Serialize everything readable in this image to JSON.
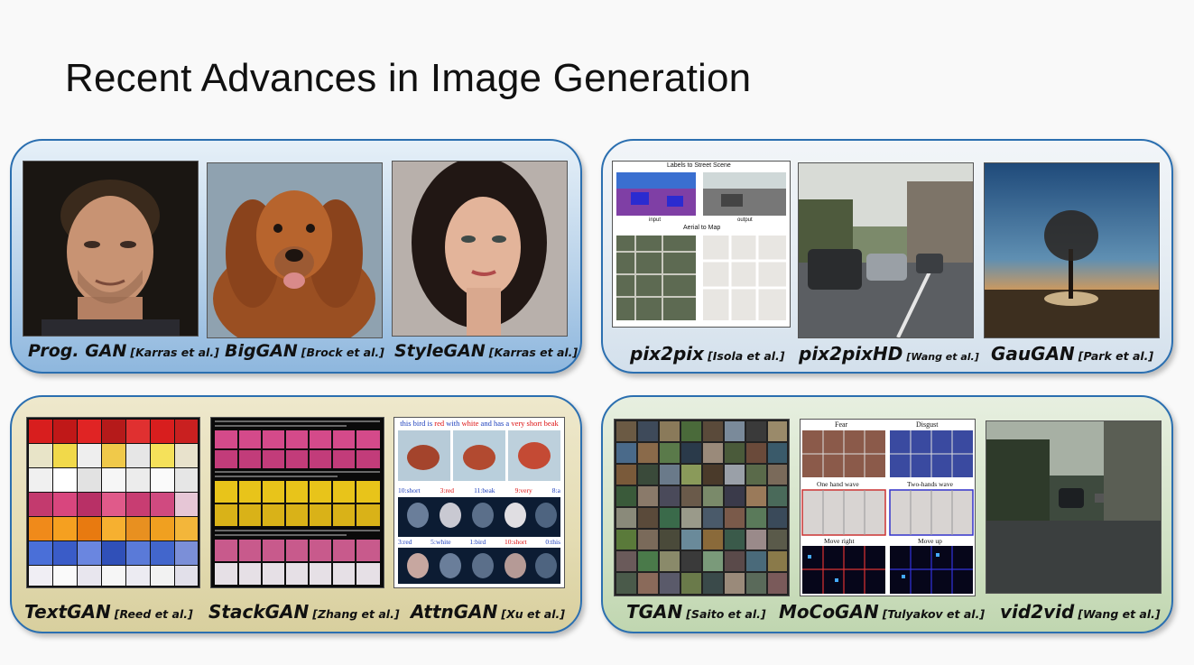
{
  "slide": {
    "title": "Recent Advances in Image Generation"
  },
  "panels": {
    "top_left": {
      "items": [
        {
          "name": "Prog. GAN",
          "cite": "[Karras et al.]"
        },
        {
          "name": "BigGAN",
          "cite": "[Brock et al.]"
        },
        {
          "name": "StyleGAN",
          "cite": "[Karras et al.]"
        }
      ]
    },
    "top_right": {
      "items": [
        {
          "name": "pix2pix",
          "cite": "[Isola et al.]"
        },
        {
          "name": "pix2pixHD",
          "cite": "[Wang et al.]"
        },
        {
          "name": "GauGAN",
          "cite": "[Park et al.]"
        }
      ],
      "figure_text": {
        "labels_to_street": "Labels to Street Scene",
        "aerial_to_map": "Aerial to Map",
        "input": "input",
        "output": "output"
      }
    },
    "bottom_left": {
      "items": [
        {
          "name": "TextGAN",
          "cite": "[Reed et al.]"
        },
        {
          "name": "StackGAN",
          "cite": "[Zhang et al.]"
        },
        {
          "name": "AttnGAN",
          "cite": "[Xu et al.]"
        }
      ],
      "figure_text": {
        "prompt_a": "this bird is",
        "prompt_red": "red",
        "prompt_b": "with",
        "prompt_white": "white",
        "prompt_c": "and has a",
        "prompt_beak": "very short beak",
        "row1": [
          "10:short",
          "3:red",
          "11:beak",
          "9:very",
          "8:a"
        ],
        "row2": [
          "3:red",
          "5:white",
          "1:bird",
          "10:short",
          "0:this"
        ]
      }
    },
    "bottom_right": {
      "items": [
        {
          "name": "TGAN",
          "cite": "[Saito et al.]"
        },
        {
          "name": "MoCoGAN",
          "cite": "[Tulyakov et al.]"
        },
        {
          "name": "vid2vid",
          "cite": "[Wang et al.]"
        }
      ],
      "figure_text": {
        "fear": "Fear",
        "disgust": "Disgust",
        "one_hand_wave": "One hand wave",
        "two_hands_wave": "Two-hands wave",
        "move_right": "Move right",
        "move_up": "Move up"
      }
    }
  }
}
